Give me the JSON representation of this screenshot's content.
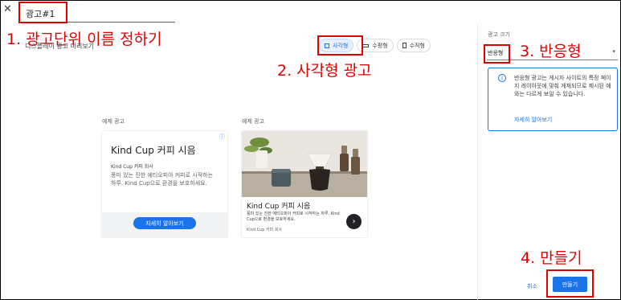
{
  "header": {
    "close_glyph": "✕",
    "name_value": "광고#1"
  },
  "annotations": {
    "step1": "1. 광고단위 이름 정하기",
    "step2": "2. 사각형 광고",
    "step3": "3. 반응형",
    "step4": "4. 만들기"
  },
  "preview": {
    "label": "디스플레이 광고 미리보기",
    "toggles": [
      "사각형",
      "수평형",
      "수직형"
    ],
    "active_toggle": "사각형"
  },
  "example_ads": {
    "label": "예제 광고",
    "ad1": {
      "info_glyph": "ⓘ",
      "title": "Kind Cup 커피 시음",
      "advertiser": "Kind Cup 커피 회사",
      "description": "풍미 있는 진한 에티오피아 커피로 시작하는 하루. Kind Cup으로 환경을 보호하세요.",
      "cta": "자세히 알아보기"
    },
    "ad2": {
      "title": "Kind Cup 커피 시음",
      "description": "풍미 있는 진한 에티오피아 커피로 시작하는 하루. Kind Cup으로 환경을 보호하세요.",
      "advertiser": "Kind Cup 커피 회사",
      "arrow_glyph": "›"
    }
  },
  "sidebar": {
    "size_label": "광고 크기",
    "size_value": "반응형",
    "caret_glyph": "▾",
    "info": {
      "icon_glyph": "i",
      "text": "반응형 광고는 게시자 사이트의 특정 페이지 레이아웃에 맞춰 게재되므로 제시된 예와는 다르게 보일 수 있습니다.",
      "link": "자세히 알아보기"
    }
  },
  "footer": {
    "cancel": "취소",
    "create": "만들기"
  },
  "colors": {
    "accent": "#1a73e8",
    "annotation": "#e00000",
    "active_toggle_bg": "#e8f0fe"
  }
}
